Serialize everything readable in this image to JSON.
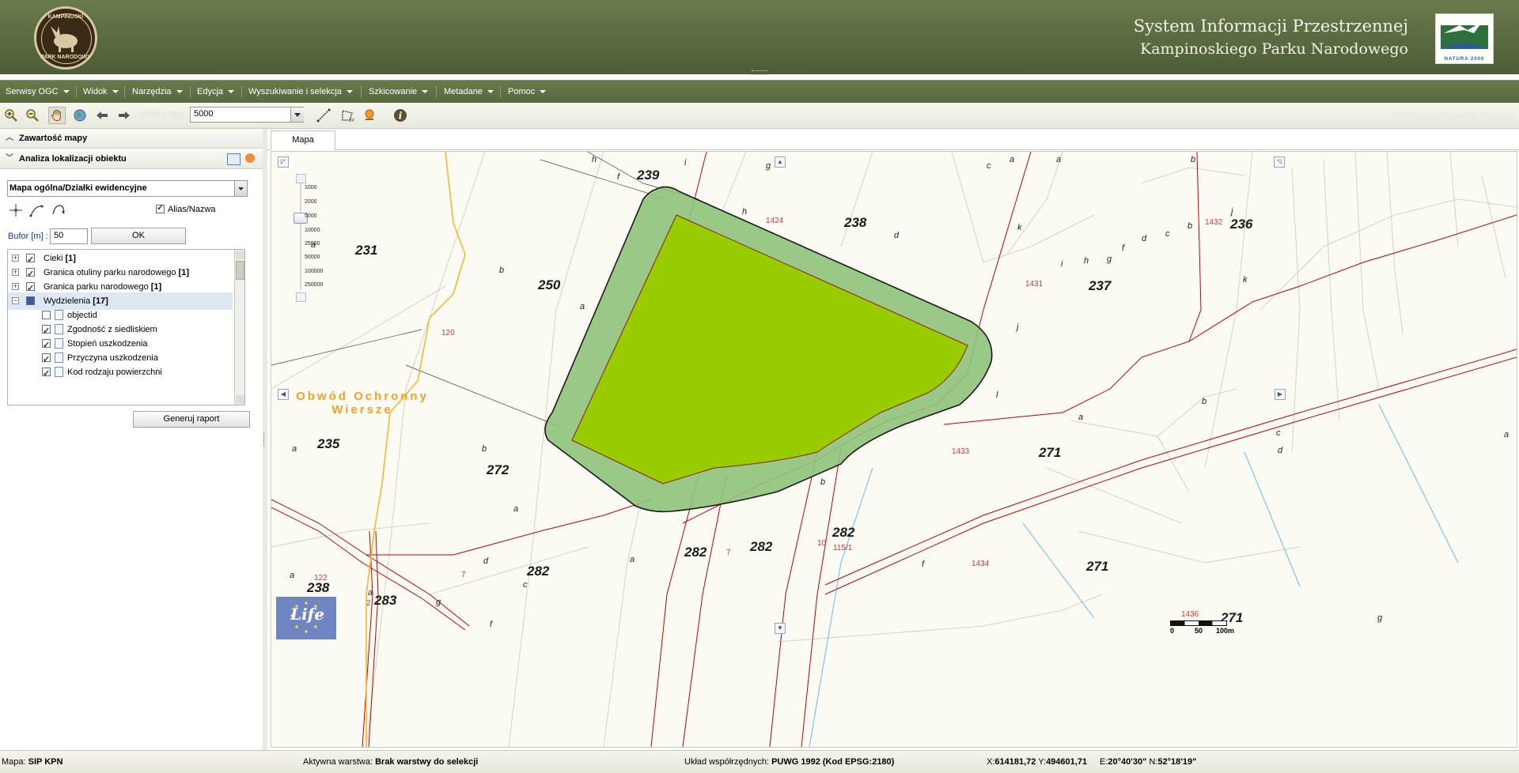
{
  "header": {
    "logo_text_top": "KAMPINOSKI",
    "logo_text_bottom": "PARK NARODOWY",
    "title_line1": "System Informacji Przestrzennej",
    "title_line2": "Kampinoskiego Parku Narodowego",
    "natura_label": "NATURA 2000"
  },
  "menu": {
    "items": [
      {
        "label": "Serwisy OGC"
      },
      {
        "label": "Widok"
      },
      {
        "label": "Narzędzia"
      },
      {
        "label": "Edycja"
      },
      {
        "label": "Wyszukiwanie i selekcja"
      },
      {
        "label": "Szkicowanie"
      },
      {
        "label": "Metadane"
      },
      {
        "label": "Pomoc"
      }
    ]
  },
  "toolbar": {
    "scale_label": "Skala mapy :",
    "scale_value": "5000",
    "login_status": "Jesteś niezalogowany (Zaloguj)",
    "icons": [
      "zoom-in-icon",
      "zoom-out-icon",
      "pan-hand-icon",
      "full-extent-globe-icon",
      "back-arrow-icon",
      "forward-arrow-icon",
      "measure-length-icon",
      "measure-area-icon",
      "clear-measure-icon",
      "info-icon"
    ]
  },
  "left_panel": {
    "section1_title": "Zawartość mapy",
    "section2_title": "Analiza lokalizacji obiektu",
    "layer_select_value": "Mapa ogólna/Działki ewidencyjne",
    "alias_label": "Alias/Nazwa",
    "alias_checked": true,
    "buffer_label": "Bufor [m] :",
    "buffer_value": "50",
    "ok_label": "OK",
    "report_label": "Generuj raport",
    "tree": [
      {
        "label": "Cieki",
        "count": "[1]",
        "expander": "+",
        "checked": true,
        "level": 0
      },
      {
        "label": "Granica otuliny parku narodowego",
        "count": "[1]",
        "expander": "+",
        "checked": true,
        "level": 0
      },
      {
        "label": "Granica parku narodowego",
        "count": "[1]",
        "expander": "+",
        "checked": true,
        "level": 0
      },
      {
        "label": "Wydzielenia",
        "count": "[17]",
        "expander": "−",
        "checked": "partial",
        "level": 0,
        "selected": true
      },
      {
        "label": "objectid",
        "checked": false,
        "level": 1
      },
      {
        "label": "Zgodność z siedliskiem",
        "checked": true,
        "level": 1
      },
      {
        "label": "Stopień uszkodzenia",
        "checked": true,
        "level": 1
      },
      {
        "label": "Przyczyna uszkodzenia",
        "checked": true,
        "level": 1
      },
      {
        "label": "Kod rodzaju powierzchni",
        "checked": true,
        "level": 1
      }
    ]
  },
  "map": {
    "tab_label": "Mapa",
    "zoom_scales": [
      "1000",
      "2000",
      "5000",
      "10000",
      "25000",
      "50000",
      "100000",
      "250000"
    ],
    "region_label_line1": "Obwód Ochronny",
    "region_label_line2": "Wiersze",
    "plot_numbers": [
      {
        "text": "239"
      },
      {
        "text": "238"
      },
      {
        "text": "236"
      },
      {
        "text": "231"
      },
      {
        "text": "250"
      },
      {
        "text": "237"
      },
      {
        "text": "235"
      },
      {
        "text": "272"
      },
      {
        "text": "271"
      },
      {
        "text": "282"
      },
      {
        "text": "282"
      },
      {
        "text": "282"
      },
      {
        "text": "282"
      },
      {
        "text": "271"
      },
      {
        "text": "238"
      },
      {
        "text": "283"
      },
      {
        "text": "271"
      }
    ],
    "parcel_numbers": [
      {
        "text": "1424"
      },
      {
        "text": "1432"
      },
      {
        "text": "1431"
      },
      {
        "text": "120"
      },
      {
        "text": "1433"
      },
      {
        "text": "7"
      },
      {
        "text": "10"
      },
      {
        "text": "115/1"
      },
      {
        "text": "1434"
      },
      {
        "text": "7"
      },
      {
        "text": "122"
      },
      {
        "text": "2"
      },
      {
        "text": "1436"
      }
    ],
    "subdivision_letters": [
      {
        "text": "h"
      },
      {
        "text": "i"
      },
      {
        "text": "f"
      },
      {
        "text": "g"
      },
      {
        "text": "c"
      },
      {
        "text": "a"
      },
      {
        "text": "a"
      },
      {
        "text": "b"
      },
      {
        "text": "h"
      },
      {
        "text": "d"
      },
      {
        "text": "k"
      },
      {
        "text": "j"
      },
      {
        "text": "b"
      },
      {
        "text": "c"
      },
      {
        "text": "d"
      },
      {
        "text": "f"
      },
      {
        "text": "g"
      },
      {
        "text": "h"
      },
      {
        "text": "i"
      },
      {
        "text": "k"
      },
      {
        "text": "a"
      },
      {
        "text": "b"
      },
      {
        "text": "a"
      },
      {
        "text": "j"
      },
      {
        "text": "l"
      },
      {
        "text": "b"
      },
      {
        "text": "a"
      },
      {
        "text": "c"
      },
      {
        "text": "d"
      },
      {
        "text": "a"
      },
      {
        "text": "b"
      },
      {
        "text": "a"
      },
      {
        "text": "b"
      },
      {
        "text": "d"
      },
      {
        "text": "a"
      },
      {
        "text": "c"
      },
      {
        "text": "f"
      },
      {
        "text": "g"
      },
      {
        "text": "a"
      },
      {
        "text": "b"
      },
      {
        "text": "f"
      },
      {
        "text": "a"
      },
      {
        "text": "g"
      },
      {
        "text": "a"
      }
    ],
    "scalebar_labels": [
      "0",
      "50",
      "100m"
    ],
    "life_logo_text": "Life",
    "colors": {
      "selected_parcel": "#99cc00",
      "buffer_zone": "#8fc27b",
      "parcel_boundary": "#c80000",
      "park_boundary": "#f5b731",
      "map_background": "#fbfaf3"
    }
  },
  "statusbar": {
    "map_label": "Mapa:",
    "map_value": "SIP KPN",
    "active_layer_label": "Aktywna warstwa:",
    "active_layer_value": "Brak warstwy do selekcji",
    "crs_label": "Układ współrzędnych:",
    "crs_value": "PUWG 1992 (Kod EPSG:2180)",
    "x_label": "X:",
    "x_value": "614181,72",
    "y_label": "Y:",
    "y_value": "494601,71",
    "e_label": "E:",
    "e_value": "20°40'30\"",
    "n_label": "N:",
    "n_value": "52°18'19\""
  }
}
